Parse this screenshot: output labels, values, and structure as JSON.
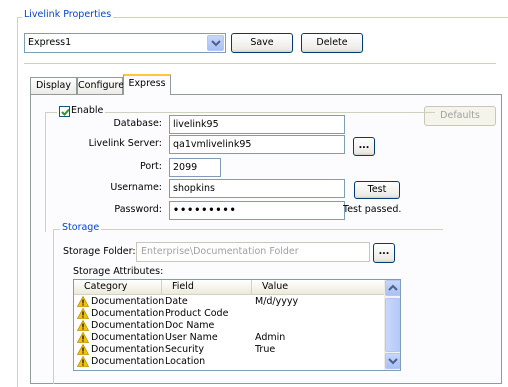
{
  "group_title": "Livelink Properties",
  "profile_select": {
    "value": "Express1"
  },
  "buttons": {
    "save": "Save",
    "delete": "Delete",
    "defaults": "Defaults",
    "test": "Test",
    "browse": "..."
  },
  "tabs": [
    {
      "label": "Display",
      "active": false
    },
    {
      "label": "Configure",
      "active": false
    },
    {
      "label": "Express",
      "active": true
    }
  ],
  "enable": {
    "label": "Enable",
    "checked": true
  },
  "form": {
    "database": {
      "label": "Database:",
      "value": "livelink95"
    },
    "server": {
      "label": "Livelink Server:",
      "value": "qa1vmlivelink95"
    },
    "port": {
      "label": "Port:",
      "value": "2099"
    },
    "username": {
      "label": "Username:",
      "value": "shopkins"
    },
    "password": {
      "label": "Password:",
      "value": "•••••••••"
    },
    "test_status": "Test passed."
  },
  "storage": {
    "title": "Storage",
    "folder_label": "Storage Folder:",
    "folder_value": "Enterprise\\Documentation Folder",
    "attributes_label": "Storage Attributes:",
    "columns": [
      "Category",
      "Field",
      "Value"
    ],
    "rows": [
      {
        "category": "Documentation",
        "field": "Date",
        "value": "M/d/yyyy"
      },
      {
        "category": "Documentation",
        "field": "Product Code",
        "value": ""
      },
      {
        "category": "Documentation",
        "field": "Doc Name",
        "value": ""
      },
      {
        "category": "Documentation",
        "field": "User Name",
        "value": "Admin"
      },
      {
        "category": "Documentation",
        "field": "Security",
        "value": "True"
      },
      {
        "category": "Documentation",
        "field": "Location",
        "value": ""
      }
    ]
  },
  "colors": {
    "accent": "#0046d5",
    "tab_highlight": "#ffc83c",
    "warning": "#f5c400"
  }
}
